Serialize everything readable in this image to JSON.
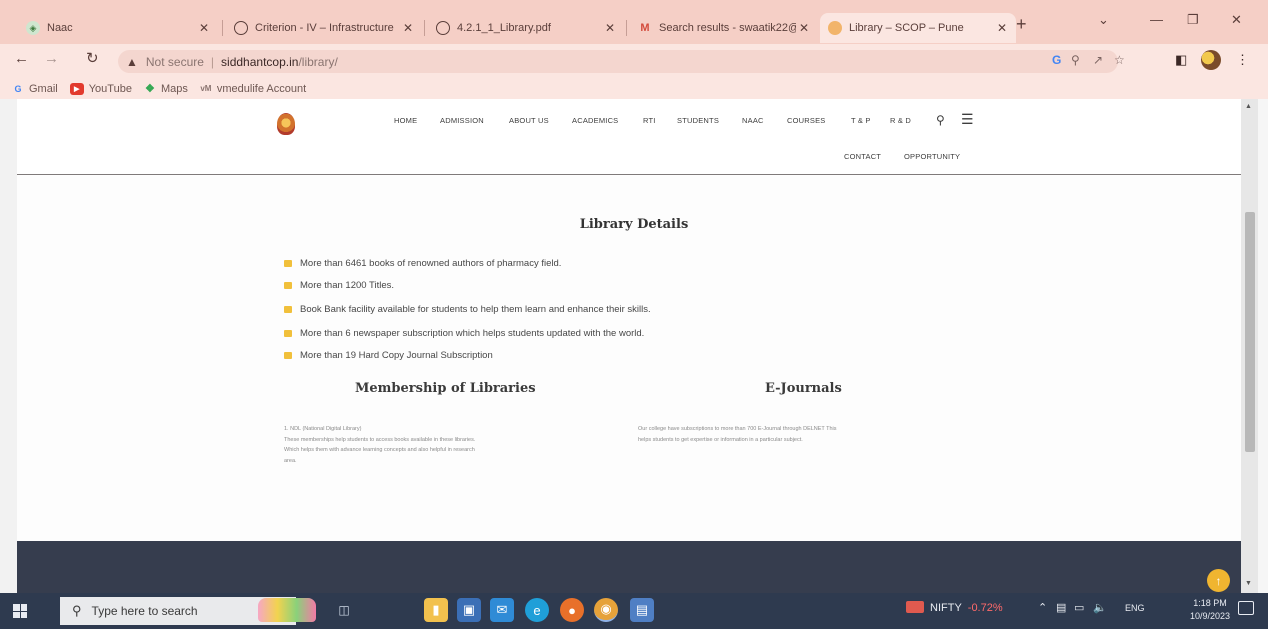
{
  "browser": {
    "tabs": [
      {
        "title": "Naac",
        "favicon": "naac-icon",
        "favicon_color": "#5a9e5a"
      },
      {
        "title": "Criterion - IV – Infrastructure",
        "favicon": "globe-icon",
        "favicon_color": "#5a3e3a"
      },
      {
        "title": "4.2.1_1_Library.pdf",
        "favicon": "globe-icon",
        "favicon_color": "#5a3e3a"
      },
      {
        "title": "Search results - swaatik22@",
        "favicon": "gmail-icon",
        "favicon_color": "#d44b3c"
      },
      {
        "title": "Library – SCOP – Pune",
        "favicon": "scop-logo-icon",
        "favicon_color": "#e0872e",
        "active": true
      }
    ],
    "new_tab": "+",
    "address": {
      "not_secure": "Not secure",
      "host": "siddhantcop.in",
      "path": "/library/"
    },
    "bookmarks": [
      {
        "label": "Gmail",
        "icon": "google-icon"
      },
      {
        "label": "YouTube",
        "icon": "youtube-icon"
      },
      {
        "label": "Maps",
        "icon": "maps-icon"
      },
      {
        "label": "vmedulife Account",
        "icon": "vmedulife-icon"
      }
    ]
  },
  "site": {
    "nav_row1": [
      "HOME",
      "ADMISSION",
      "ABOUT US",
      "ACADEMICS",
      "RTI",
      "STUDENTS",
      "NAAC",
      "COURSES",
      "T & P",
      "R & D"
    ],
    "nav_row2": [
      "CONTACT",
      "OPPORTUNITY"
    ],
    "library_title": "Library Details",
    "library_items": [
      "More than 6461 books of renowned authors of pharmacy field.",
      "More than 1200 Titles.",
      "Book Bank facility available for students to help them learn and enhance their skills.",
      "More than 6 newspaper subscription which helps students updated with the world.",
      "More than 19 Hard Copy Journal Subscription"
    ],
    "membership": {
      "title": "Membership of Libraries",
      "line1": "1. NDL (National Digital Library)",
      "line2": "These memberships help students to access books available in these libraries.",
      "line3": "Which helps them with advance learning concepts and also helpful in research",
      "line4": "area."
    },
    "ejournals": {
      "title": "E-Journals",
      "line1": "Our college have subscriptions to more than 700 E-Journal through DELNET This",
      "line2": "helps students to get expertise or information in a particular subject."
    }
  },
  "taskbar": {
    "search_placeholder": "Type here to search",
    "nifty_label": "NIFTY",
    "nifty_change": "-0.72%",
    "language": "ENG",
    "time": "1:18 PM",
    "date": "10/9/2023"
  }
}
